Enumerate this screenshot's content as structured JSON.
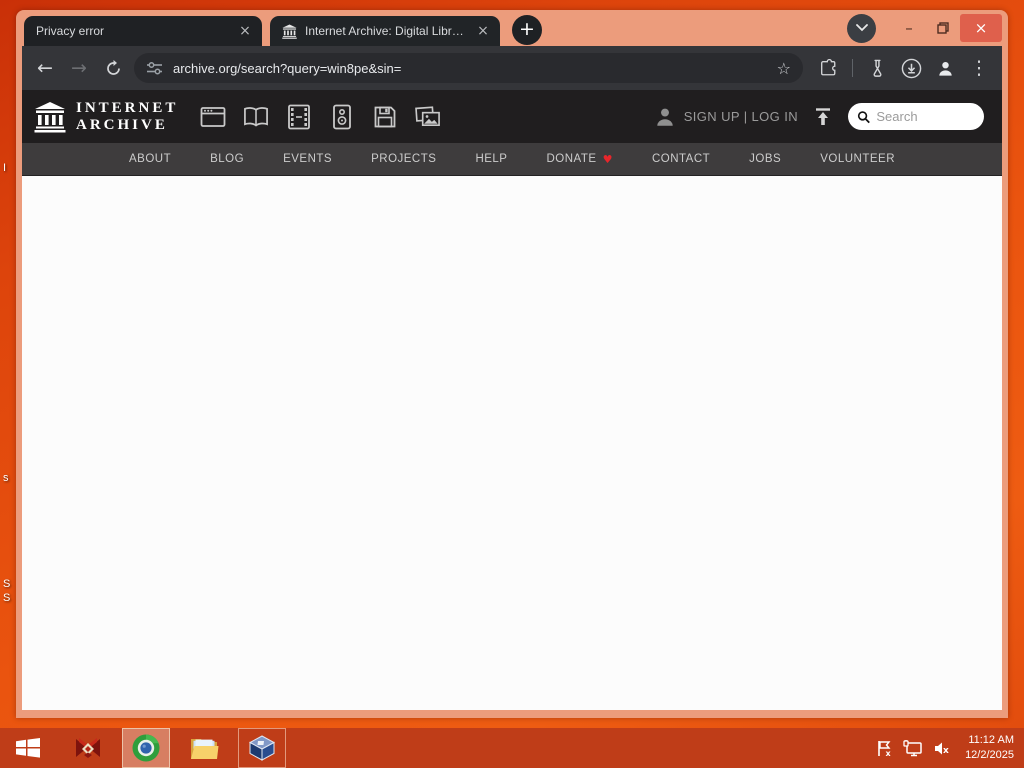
{
  "colors": {
    "desktop": "#e24a0e",
    "window_frame": "#ec9c7c",
    "taskbar": "#bf3d18",
    "toolbar": "#343539",
    "tab_background": "#1f2124",
    "ia_header": "#201e1f",
    "nav_bar": "#3e3c3d",
    "heart_red": "#e8262b",
    "close_button_red": "#df604c",
    "search_box": "#ffffff"
  },
  "titlebar": {
    "tabs": [
      {
        "title": "Privacy error"
      },
      {
        "title": "Internet Archive: Digital Library"
      }
    ]
  },
  "toolbar": {
    "url": "archive.org/search?query=win8pe&sin="
  },
  "ia_header": {
    "wordmark_line1": "INTERNET",
    "wordmark_line2": "ARCHIVE",
    "auth_text": "SIGN UP | LOG IN",
    "search_placeholder": "Search"
  },
  "nav": {
    "items": [
      "ABOUT",
      "BLOG",
      "EVENTS",
      "PROJECTS",
      "HELP",
      "DONATE",
      "CONTACT",
      "JOBS",
      "VOLUNTEER"
    ]
  },
  "taskbar": {
    "time": "11:12 AM",
    "date": "12/2/2025"
  },
  "desktop": {
    "fragments": [
      "I",
      "s",
      "S",
      "S"
    ]
  },
  "icons": {
    "close": "×",
    "new_tab": "+",
    "back": "←",
    "forward": "→",
    "star": "☆",
    "kebab": "⋮",
    "heart": "♥",
    "minimize": "–"
  }
}
